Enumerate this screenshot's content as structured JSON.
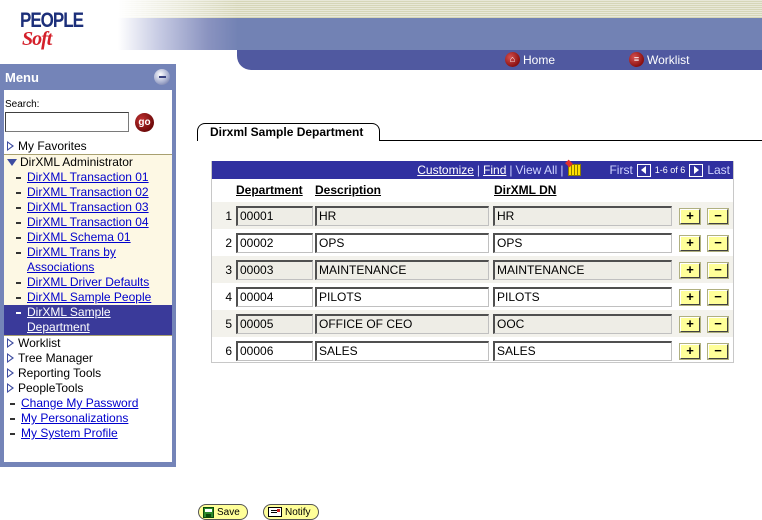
{
  "header": {
    "logo_top": "PEOPLE",
    "logo_bottom": "Soft",
    "nav": [
      {
        "label": "Home",
        "icon": "home-icon"
      },
      {
        "label": "Worklist",
        "icon": "worklist-icon"
      }
    ]
  },
  "sidebar": {
    "title": "Menu",
    "search_label": "Search:",
    "search_value": "",
    "go_label": "go",
    "favorites": "My Favorites",
    "admin": {
      "label": "DirXML Administrator",
      "items": [
        "DirXML Transaction 01",
        "DirXML Transaction 02",
        "DirXML Transaction 03",
        "DirXML Transaction 04",
        "DirXML Schema 01",
        "DirXML Trans by Associations",
        "DirXML Driver Defaults",
        "DirXML Sample People",
        "DirXML Sample Department"
      ],
      "active_index": 8
    },
    "folders": [
      "Worklist",
      "Tree Manager",
      "Reporting Tools",
      "PeopleTools"
    ],
    "links": [
      "Change My Password",
      "My Personalizations",
      "My System Profile"
    ]
  },
  "page": {
    "tab_label": "Dirxml Sample Department",
    "grid": {
      "customize": "Customize",
      "find": "Find",
      "view_all": "View All",
      "first": "First",
      "range": "1-6 of 6",
      "last": "Last",
      "columns": [
        "Department",
        "Description",
        "DirXML DN"
      ],
      "rows": [
        {
          "num": "1",
          "dept": "00001",
          "desc": "HR",
          "dn": "HR"
        },
        {
          "num": "2",
          "dept": "00002",
          "desc": "OPS",
          "dn": "OPS"
        },
        {
          "num": "3",
          "dept": "00003",
          "desc": "MAINTENANCE",
          "dn": "MAINTENANCE"
        },
        {
          "num": "4",
          "dept": "00004",
          "desc": "PILOTS",
          "dn": "PILOTS"
        },
        {
          "num": "5",
          "dept": "00005",
          "desc": "OFFICE OF CEO",
          "dn": "OOC"
        },
        {
          "num": "6",
          "dept": "00006",
          "desc": "SALES",
          "dn": "SALES"
        }
      ],
      "add_label": "+",
      "delete_label": "−"
    }
  },
  "footer": {
    "save_label": "Save",
    "notify_label": "Notify"
  }
}
